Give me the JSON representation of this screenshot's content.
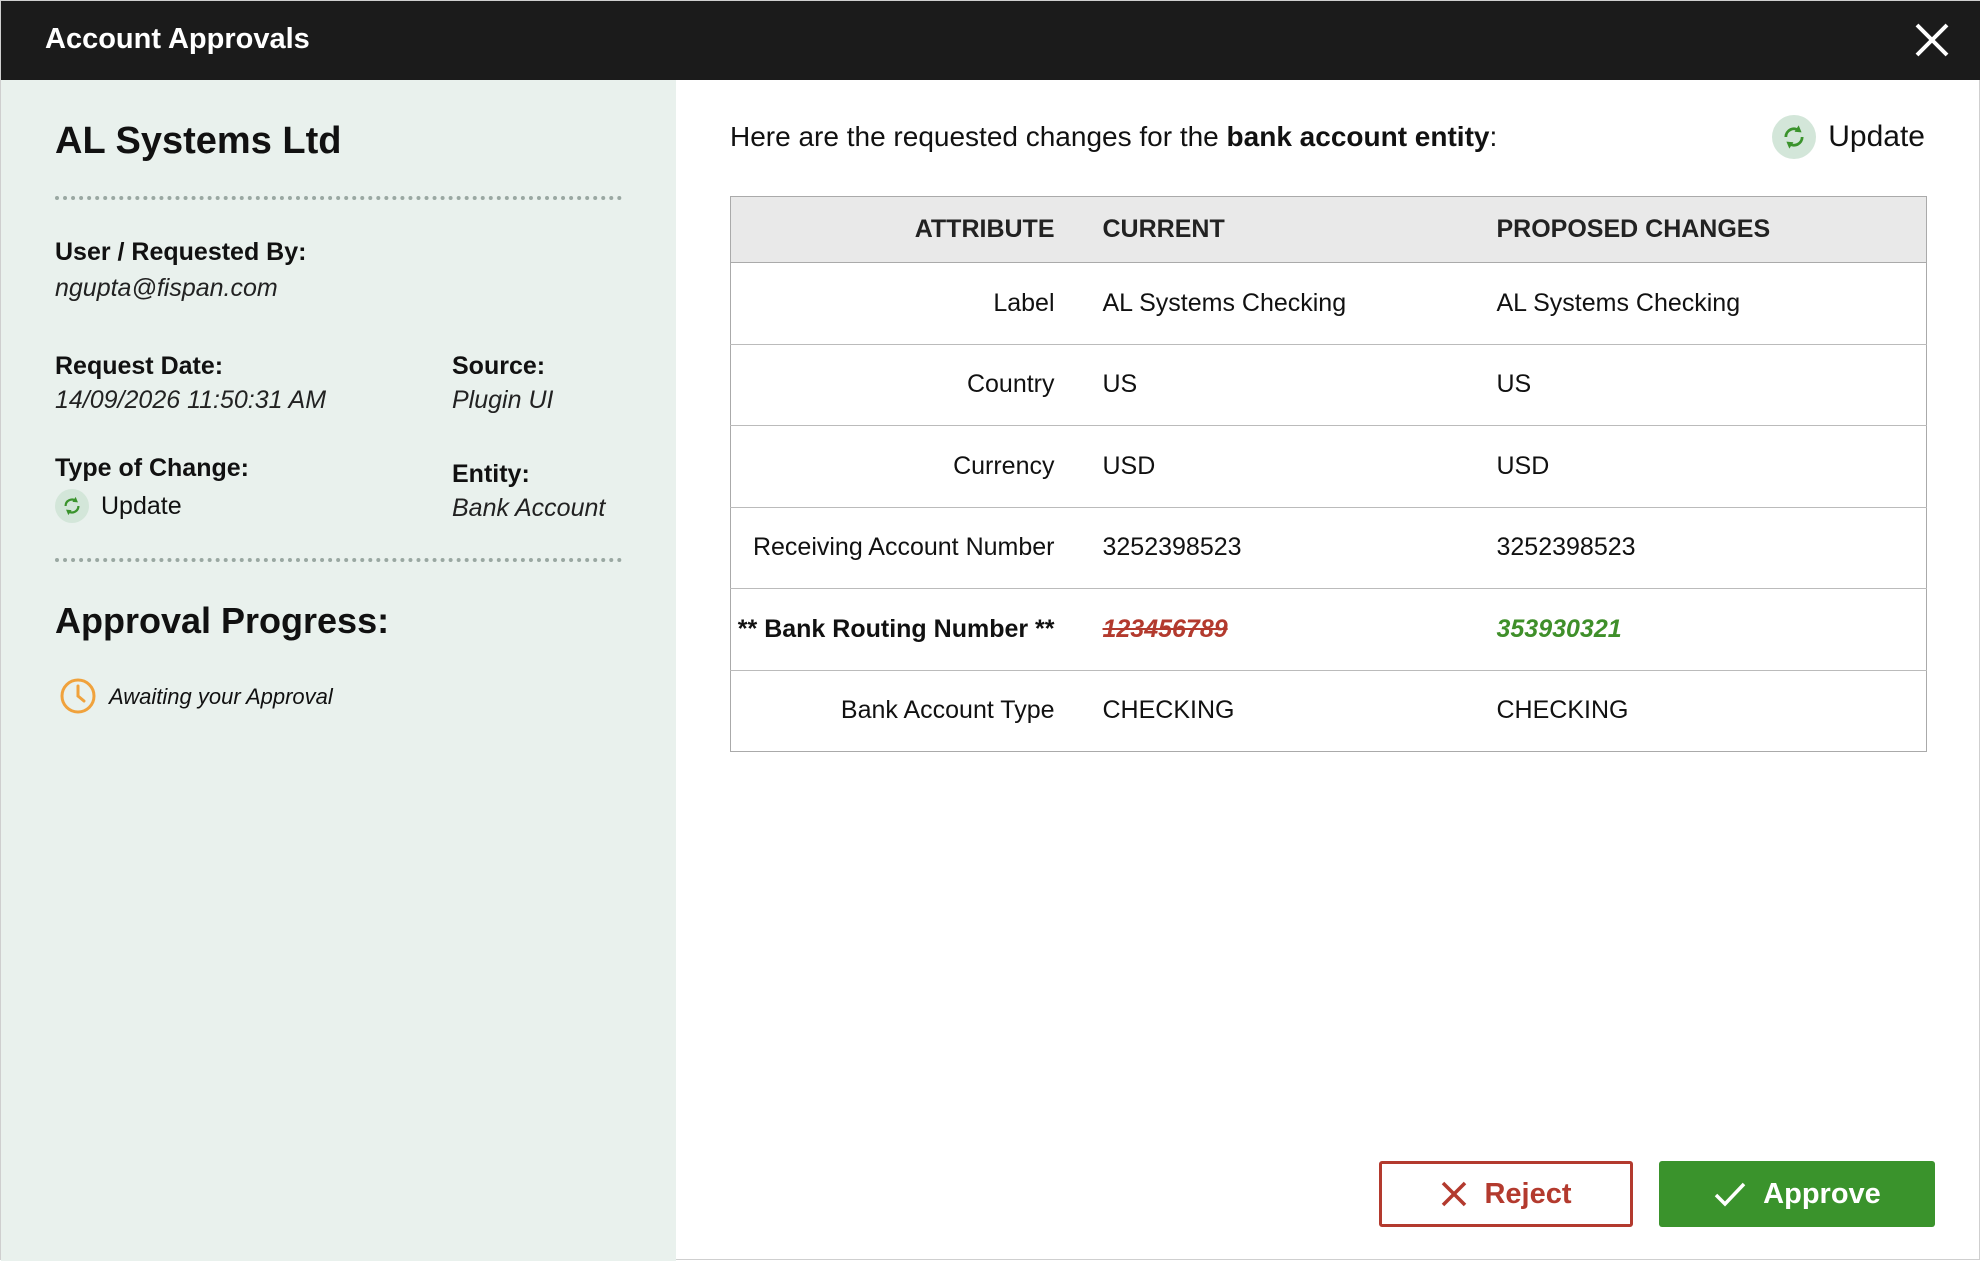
{
  "window": {
    "title": "Account Approvals"
  },
  "summary": {
    "company": "AL Systems Ltd",
    "requested_by_label": "User / Requested By:",
    "requested_by_value": "ngupta@fispan.com",
    "request_date_label": "Request Date:",
    "request_date_value": "14/09/2026 11:50:31 AM",
    "source_label": "Source:",
    "source_value": "Plugin UI",
    "type_label": "Type of Change:",
    "type_value": "Update",
    "entity_label": "Entity:",
    "entity_value": "Bank Account"
  },
  "progress": {
    "title": "Approval Progress:",
    "status": "Awaiting your Approval",
    "status_color": "#f0a23c"
  },
  "main": {
    "intro_prefix": "Here are the requested changes for the ",
    "intro_bold": "bank account entity",
    "intro_suffix": ":",
    "change_type": "Update"
  },
  "table": {
    "headers": {
      "attribute": "ATTRIBUTE",
      "current": "CURRENT",
      "proposed": "PROPOSED CHANGES"
    },
    "rows": [
      {
        "attribute": "Label",
        "current": "AL Systems Checking",
        "proposed": "AL Systems Checking"
      },
      {
        "attribute": "Country",
        "current": "US",
        "proposed": "US"
      },
      {
        "attribute": "Currency",
        "current": "USD",
        "proposed": "USD"
      },
      {
        "attribute": "Receiving Account Number",
        "current": "3252398523",
        "proposed": "3252398523"
      },
      {
        "attribute": "** Bank Routing Number **",
        "current": "123456789",
        "proposed": "353930321"
      },
      {
        "attribute": "Bank Account Type",
        "current": "CHECKING",
        "proposed": "CHECKING"
      }
    ]
  },
  "actions": {
    "reject_label": "Reject",
    "approve_label": "Approve"
  },
  "colors": {
    "reject": "#b33a2e",
    "approve": "#3a932c",
    "titlebar": "#1b1b1b",
    "sidebar": "#e9f1ed"
  }
}
